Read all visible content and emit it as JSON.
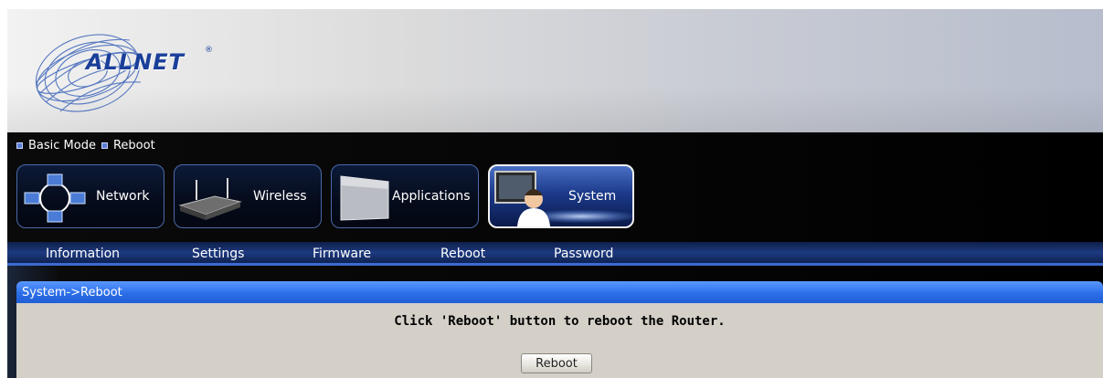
{
  "brand": {
    "logo_text": "ALLNET",
    "registered_mark": "®"
  },
  "breadcrumb": {
    "items": [
      "Basic Mode",
      "Reboot"
    ]
  },
  "main_nav": {
    "items": [
      {
        "label": "Network",
        "icon": "network-icon",
        "active": false
      },
      {
        "label": "Wireless",
        "icon": "router-icon",
        "active": false
      },
      {
        "label": "Applications",
        "icon": "applications-icon",
        "active": false
      },
      {
        "label": "System",
        "icon": "system-user-icon",
        "active": true
      }
    ]
  },
  "sub_nav": {
    "items": [
      "Information",
      "Settings",
      "Firmware",
      "Reboot",
      "Password"
    ]
  },
  "panel": {
    "title": "System->Reboot",
    "message": "Click 'Reboot' button to reboot the Router.",
    "button_label": "Reboot"
  },
  "colors": {
    "accent_blue": "#2c6fe8",
    "logo_blue": "#1a3f9a",
    "panel_gray": "#d4d0c8"
  }
}
